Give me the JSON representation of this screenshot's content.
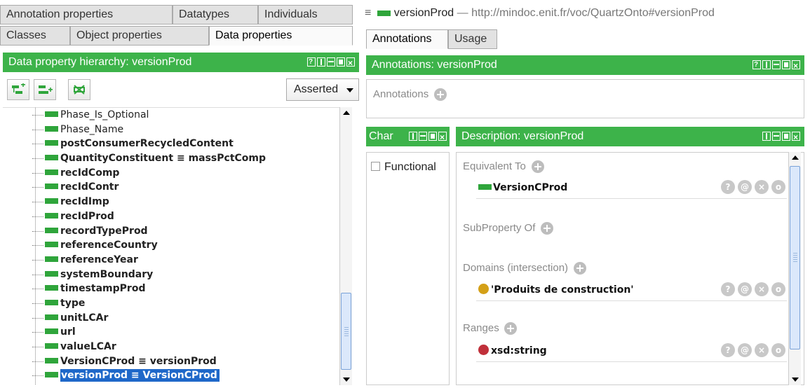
{
  "left_tabs_row1": [
    "Annotation properties",
    "Datatypes",
    "Individuals"
  ],
  "left_tabs_row2": [
    "Classes",
    "Object properties",
    "Data properties"
  ],
  "hierarchy": {
    "title": "Data property hierarchy: versionProd",
    "mode": "Asserted"
  },
  "tree_items": [
    {
      "label": "Phase_Is_Optional",
      "bold": false
    },
    {
      "label": "Phase_Name",
      "bold": false
    },
    {
      "label": "postConsumerRecycledContent",
      "bold": true
    },
    {
      "label": "QuantityConstituent ≡ massPctComp",
      "bold": true
    },
    {
      "label": "recIdComp",
      "bold": true
    },
    {
      "label": "recIdContr",
      "bold": true
    },
    {
      "label": "recIdImp",
      "bold": true
    },
    {
      "label": "recIdProd",
      "bold": true
    },
    {
      "label": "recordTypeProd",
      "bold": true
    },
    {
      "label": "referenceCountry",
      "bold": true
    },
    {
      "label": "referenceYear",
      "bold": true
    },
    {
      "label": "systemBoundary",
      "bold": true
    },
    {
      "label": "timestampProd",
      "bold": true
    },
    {
      "label": "type",
      "bold": true
    },
    {
      "label": "unitLCAr",
      "bold": true
    },
    {
      "label": "url",
      "bold": true
    },
    {
      "label": "valueLCAr",
      "bold": true
    },
    {
      "label": "VersionCProd ≡ versionProd",
      "bold": true
    },
    {
      "label": "versionProd ≡ VersionCProd",
      "bold": true,
      "selected": true
    }
  ],
  "entity": {
    "name": "versionProd",
    "iri": " — http://mindoc.enit.fr/voc/QuartzOnto#versionProd"
  },
  "right_tabs": [
    "Annotations",
    "Usage"
  ],
  "annotations": {
    "bar_title": "Annotations: versionProd",
    "section": "Annotations"
  },
  "characteristics": {
    "bar_title": "Char",
    "functional": "Functional"
  },
  "description": {
    "bar_title": "Description: versionProd",
    "equivalent_to": "Equivalent To",
    "equivalent_value": "VersionCProd",
    "subproperty_of": "SubProperty Of",
    "domains": "Domains (intersection)",
    "domain_value": "'Produits de construction'",
    "ranges": "Ranges",
    "range_value": "xsd:string"
  },
  "colors": {
    "header_green": "#3db34a",
    "property_green": "#2fa53b",
    "selection_blue": "#1f68c9",
    "domain_dot": "#d4a017",
    "range_dot": "#c0303a"
  },
  "row_icons": [
    "?",
    "@",
    "×",
    "o"
  ]
}
